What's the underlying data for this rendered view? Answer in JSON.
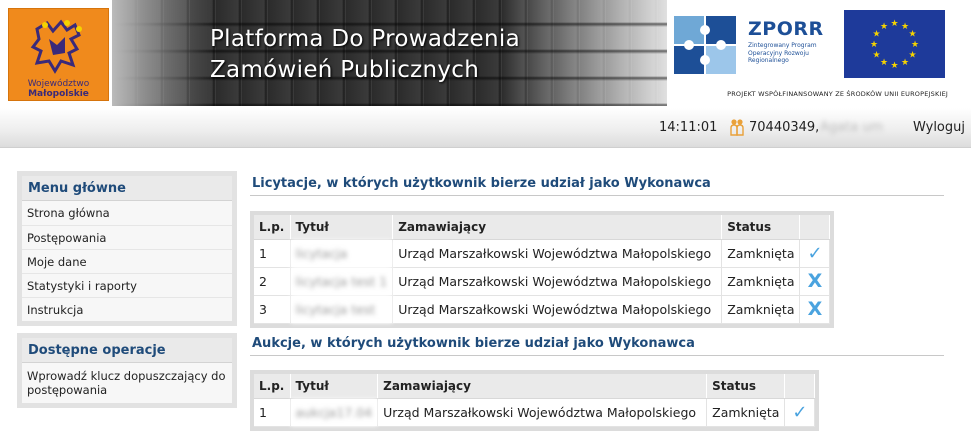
{
  "header": {
    "logo_left_line1": "Województwo",
    "logo_left_line2": "Małopolskie",
    "title_line1": "Platforma Do Prowadzenia",
    "title_line2": "Zamówień Publicznych",
    "zporr_name": "ZPORR",
    "zporr_sub": "Zintegrowany Program Operacyjny Rozwoju Regionalnego",
    "project_note": "PROJEKT WSPÓŁFINANSOWANY ZE ŚRODKÓW UNII EUROPEJSKIEJ"
  },
  "statusbar": {
    "time": "14:11:01",
    "user_id": "70440349,",
    "user_name": "Agata um",
    "logout": "Wyloguj"
  },
  "sidebar": {
    "menu_title": "Menu główne",
    "items": [
      {
        "label": "Strona główna"
      },
      {
        "label": "Postępowania"
      },
      {
        "label": "Moje dane"
      },
      {
        "label": "Statystyki i raporty"
      },
      {
        "label": "Instrukcja"
      }
    ],
    "ops_title": "Dostępne operacje",
    "ops_items": [
      {
        "label": "Wprowadź klucz dopuszczający do postępowania"
      }
    ]
  },
  "licytacje": {
    "title": "Licytacje, w których użytkownik bierze udział jako Wykonawca",
    "headers": {
      "lp": "L.p.",
      "tytul": "Tytuł",
      "zamawiajacy": "Zamawiający",
      "status": "Status"
    },
    "rows": [
      {
        "lp": "1",
        "tytul": "licytacja",
        "zamawiajacy": "Urząd Marszałkowski Województwa Małopolskiego",
        "status": "Zamknięta",
        "icon": "check-icon"
      },
      {
        "lp": "2",
        "tytul": "licytacja test 1",
        "zamawiajacy": "Urząd Marszałkowski Województwa Małopolskiego",
        "status": "Zamknięta",
        "icon": "x-icon"
      },
      {
        "lp": "3",
        "tytul": "licytacja test",
        "zamawiajacy": "Urząd Marszałkowski Województwa Małopolskiego",
        "status": "Zamknięta",
        "icon": "x-icon"
      }
    ]
  },
  "aukcje": {
    "title": "Aukcje, w których użytkownik bierze udział jako Wykonawca",
    "headers": {
      "lp": "L.p.",
      "tytul": "Tytuł",
      "zamawiajacy": "Zamawiający",
      "status": "Status"
    },
    "rows": [
      {
        "lp": "1",
        "tytul": "aukcja17.04",
        "zamawiajacy": "Urząd Marszałkowski Województwa Małopolskiego",
        "status": "Zamknięta",
        "icon": "check-icon"
      }
    ]
  },
  "colors": {
    "accent": "#1f4b7a",
    "icon": "#4aa3df",
    "brand_orange": "#f08a1c",
    "eu_blue": "#1e3a9a"
  }
}
